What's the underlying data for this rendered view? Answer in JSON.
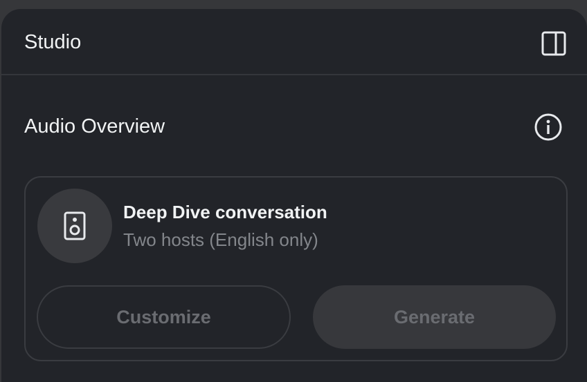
{
  "header": {
    "title": "Studio",
    "collapse_icon": "panel-toggle-icon"
  },
  "audio_overview": {
    "title": "Audio Overview",
    "info_icon": "info-icon",
    "card": {
      "icon": "speaker-icon",
      "title": "Deep Dive conversation",
      "subtitle": "Two hosts (English only)",
      "customize_label": "Customize",
      "generate_label": "Generate"
    }
  },
  "colors": {
    "panel_bg": "#222429",
    "outer_bg": "#36373a",
    "text_primary": "#f1f3f4",
    "text_secondary": "#83868b",
    "button_disabled_text": "#6a6c71"
  }
}
